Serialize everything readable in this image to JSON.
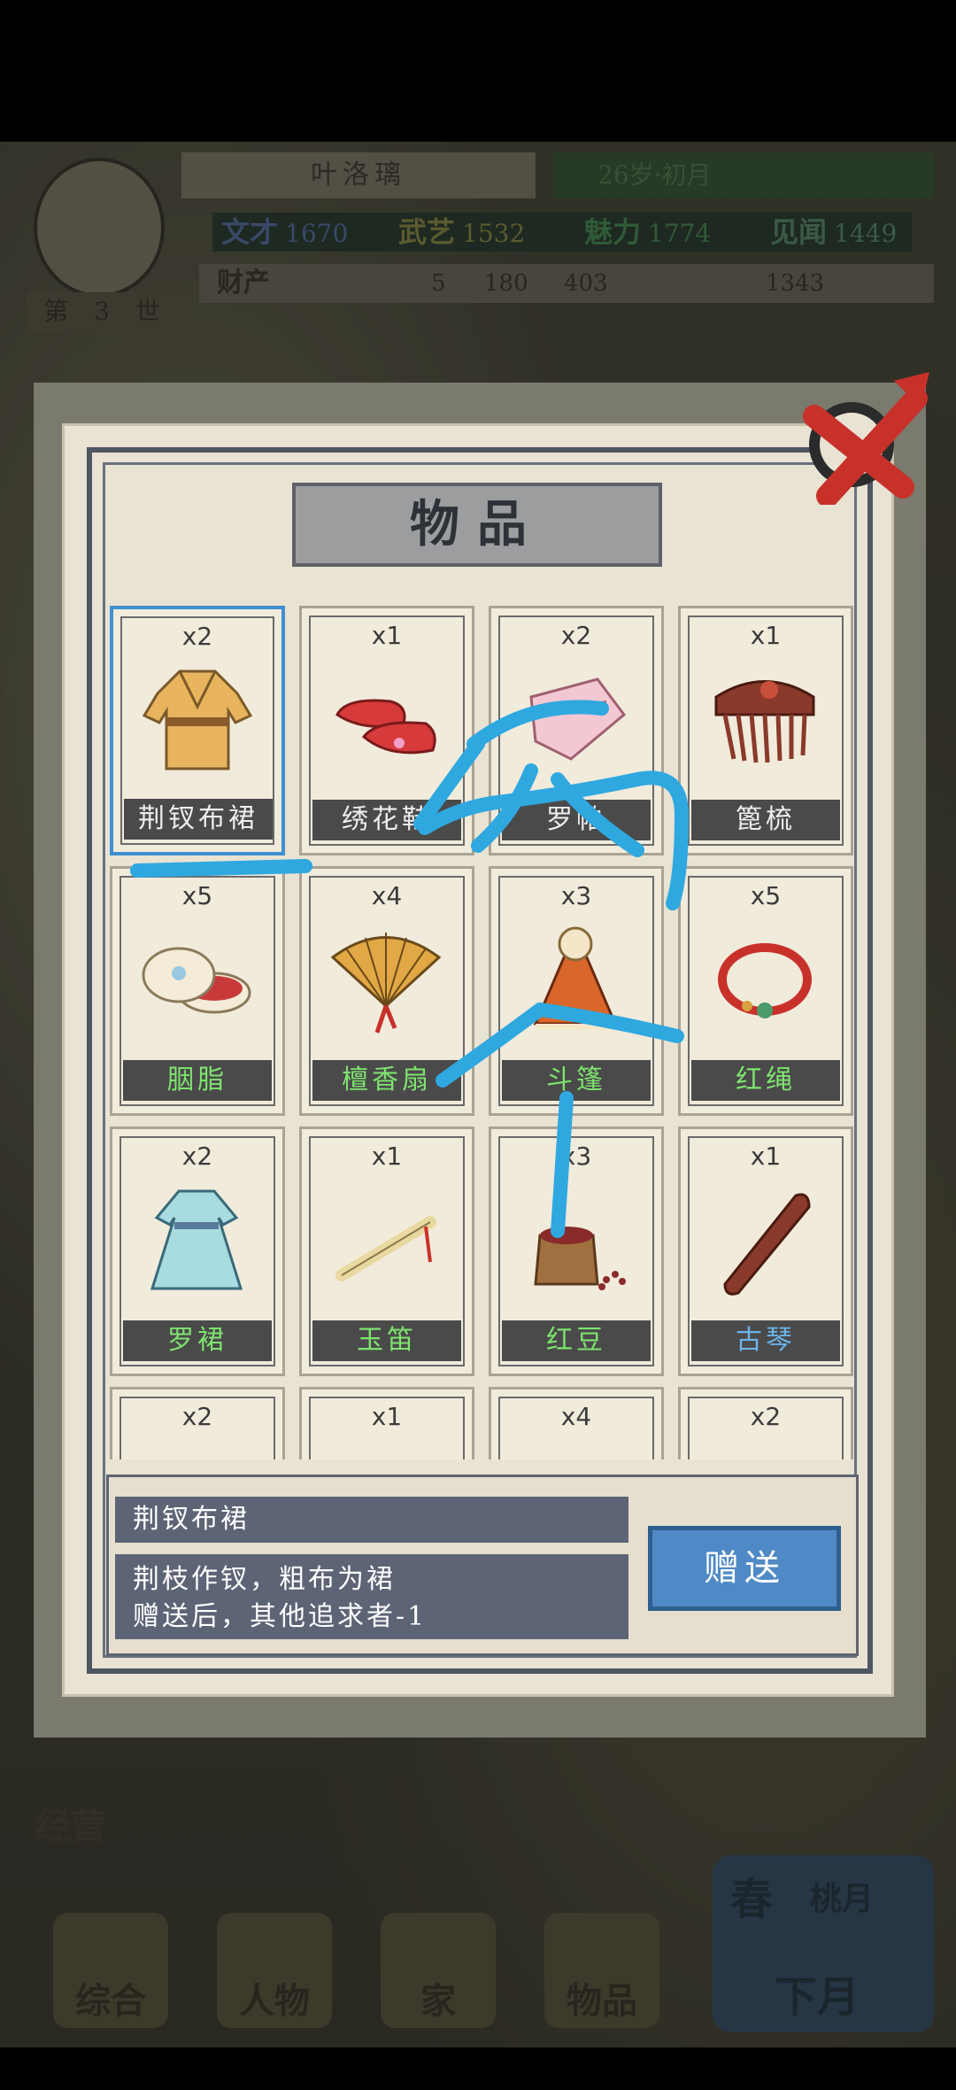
{
  "header": {
    "character_name": "叶洛璃",
    "age": "26岁·初月",
    "generation": "第 3 世",
    "stats": [
      {
        "label": "文才",
        "value": "1670"
      },
      {
        "label": "武艺",
        "value": "1532"
      },
      {
        "label": "魅力",
        "value": "1774"
      },
      {
        "label": "见闻",
        "value": "1449"
      }
    ],
    "wealth_label": "财产",
    "wealth": {
      "gold": "5",
      "silver": "180",
      "copper": "403",
      "other": "1343"
    }
  },
  "dialog": {
    "title": "物品",
    "items": [
      {
        "count": "x2",
        "name": "荆钗布裙",
        "icon": "robe-icon",
        "name_color": "white",
        "selected": true
      },
      {
        "count": "x1",
        "name": "绣花鞋",
        "icon": "embroidered-shoes-icon",
        "name_color": "white"
      },
      {
        "count": "x2",
        "name": "罗帕",
        "icon": "handkerchief-icon",
        "name_color": "white"
      },
      {
        "count": "x1",
        "name": "篦梳",
        "icon": "comb-icon",
        "name_color": "white"
      },
      {
        "count": "x5",
        "name": "胭脂",
        "icon": "rouge-box-icon",
        "name_color": "green"
      },
      {
        "count": "x4",
        "name": "檀香扇",
        "icon": "fan-icon",
        "name_color": "green"
      },
      {
        "count": "x3",
        "name": "斗篷",
        "icon": "cloak-icon",
        "name_color": "green"
      },
      {
        "count": "x5",
        "name": "红绳",
        "icon": "red-rope-icon",
        "name_color": "green"
      },
      {
        "count": "x2",
        "name": "罗裙",
        "icon": "dress-icon",
        "name_color": "green"
      },
      {
        "count": "x1",
        "name": "玉笛",
        "icon": "flute-icon",
        "name_color": "green"
      },
      {
        "count": "x3",
        "name": "红豆",
        "icon": "red-beans-icon",
        "name_color": "green"
      },
      {
        "count": "x1",
        "name": "古琴",
        "icon": "guqin-icon",
        "name_color": "blue"
      },
      {
        "count": "x2",
        "name": "",
        "icon": "item-icon"
      },
      {
        "count": "x1",
        "name": "",
        "icon": "item-icon"
      },
      {
        "count": "x4",
        "name": "",
        "icon": "item-icon"
      },
      {
        "count": "x2",
        "name": "",
        "icon": "item-icon"
      }
    ],
    "selected_name": "荆钗布裙",
    "selected_desc_line1": "荆枝作钗，粗布为裙",
    "selected_desc_line2": "赠送后，其他追求者-1",
    "gift_button": "赠送"
  },
  "bottom_nav": {
    "manage_label": "经营",
    "items": [
      "综合",
      "人物",
      "家",
      "物品"
    ],
    "season_label": "春",
    "month_label": "桃月",
    "next_month": "下月"
  },
  "colors": {
    "selection": "#3f8fd2",
    "gift_button": "#4f8ac6",
    "rare_name": "#7ee36f",
    "epic_name": "#6ab4ea",
    "scribble": "#2fa8e0"
  }
}
